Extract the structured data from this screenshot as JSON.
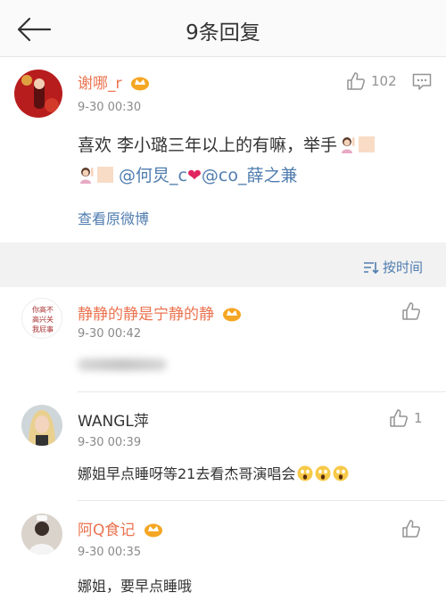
{
  "nav": {
    "title": "9条回复"
  },
  "post": {
    "username": "谢哪_r",
    "time": "9-30 00:30",
    "like_count": "102",
    "text_line1": "喜欢 李小璐三年以上的有嘛，举手",
    "mention1": "@何炅_c",
    "mention2": "@co_薛之兼",
    "view_original": "查看原微博"
  },
  "sort": {
    "label": "按时间"
  },
  "replies": [
    {
      "username": "静静的静是宁静的静",
      "time": "9-30 00:42",
      "avatar_text": "你高不高兴关我屁事"
    },
    {
      "username": "WANGL萍",
      "time": "9-30 00:39",
      "text": "娜姐早点睡呀等21去看杰哥演唱会"
    },
    {
      "username": "阿Q食记",
      "time": "9-30 00:35",
      "text": "娜姐，要早点睡哦"
    }
  ],
  "colors": {
    "username": "#eb7350",
    "link": "#507daf",
    "text": "#333333",
    "meta": "#8a8a8a"
  }
}
